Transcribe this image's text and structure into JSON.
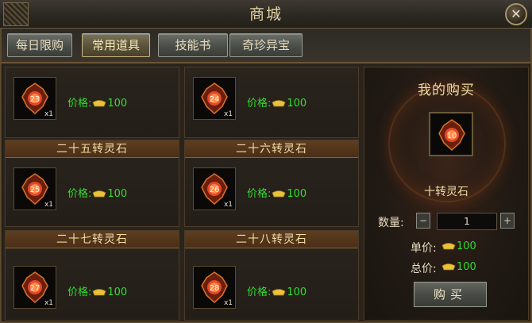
{
  "window": {
    "title": "商城"
  },
  "tabs": [
    {
      "label": "每日限购"
    },
    {
      "label": "常用道具"
    },
    {
      "label": "技能书"
    },
    {
      "label": "奇珍异宝"
    }
  ],
  "active_tab": "常用道具",
  "items": [
    {
      "name": "",
      "level": "23",
      "qty": "x1",
      "price_label": "价格:",
      "price": "100"
    },
    {
      "name": "",
      "level": "24",
      "qty": "x1",
      "price_label": "价格:",
      "price": "100"
    },
    {
      "name": "二十五转灵石",
      "level": "25",
      "qty": "x1",
      "price_label": "价格:",
      "price": "100"
    },
    {
      "name": "二十六转灵石",
      "level": "26",
      "qty": "x1",
      "price_label": "价格:",
      "price": "100"
    },
    {
      "name": "二十七转灵石",
      "level": "27",
      "qty": "x1",
      "price_label": "价格:",
      "price": "100"
    },
    {
      "name": "二十八转灵石",
      "level": "28",
      "qty": "x1",
      "price_label": "价格:",
      "price": "100"
    }
  ],
  "purchase": {
    "title": "我的购买",
    "item_level": "10",
    "item_name": "十转灵石",
    "quantity_label": "数量:",
    "minus": "−",
    "quantity": "1",
    "plus": "+",
    "unit_price_label": "单价:",
    "unit_price": "100",
    "total_price_label": "总价:",
    "total_price": "100",
    "buy_label": "购买"
  },
  "colors": {
    "price_green": "#33dd33",
    "gold": "#f2dfa6",
    "ingot": "#e8c23a"
  },
  "icons": {
    "close": "close-icon",
    "currency": "gold-ingot-icon",
    "gem": "spirit-stone-icon"
  }
}
